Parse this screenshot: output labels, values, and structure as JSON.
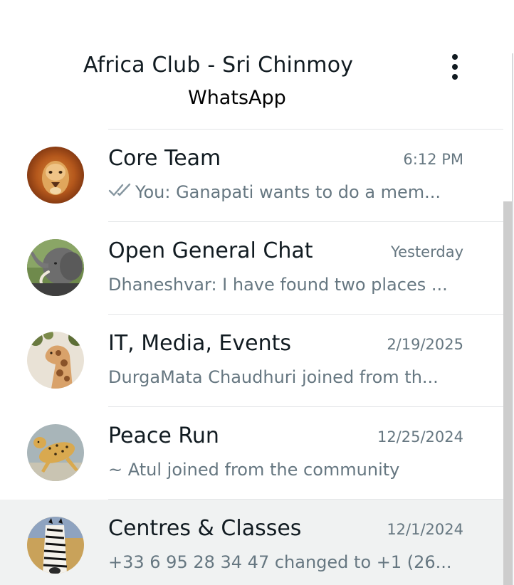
{
  "header": {
    "title": "Africa Club - Sri Chinmoy",
    "subtitle": "WhatsApp",
    "menu_icon": "more-vertical-icon"
  },
  "chats": [
    {
      "name": "Core Team",
      "time": "6:12 PM",
      "preview": "You: Ganapati wants to do a mem...",
      "status_icon": "double-check-icon",
      "avatar_icon": "lion-avatar"
    },
    {
      "name": "Open General Chat",
      "time": "Yesterday",
      "preview": "Dhaneshvar: I have found two places ...",
      "avatar_icon": "elephant-avatar"
    },
    {
      "name": "IT, Media, Events",
      "time": "2/19/2025",
      "preview": "DurgaMata Chaudhuri joined from th...",
      "avatar_icon": "giraffe-avatar"
    },
    {
      "name": "Peace Run",
      "time": "12/25/2024",
      "preview": "~ Atul joined from the community",
      "avatar_icon": "cheetah-avatar"
    },
    {
      "name": "Centres & Classes",
      "time": "12/1/2024",
      "preview": "+33 6 95 28 34 47 changed to +1 (26...",
      "avatar_icon": "zebra-avatar",
      "active": true
    }
  ],
  "colors": {
    "primary_text": "#111b21",
    "secondary_text": "#667781",
    "divider": "#e3e5e7",
    "active_row": "#f0f2f2",
    "tick": "#8696a0"
  }
}
